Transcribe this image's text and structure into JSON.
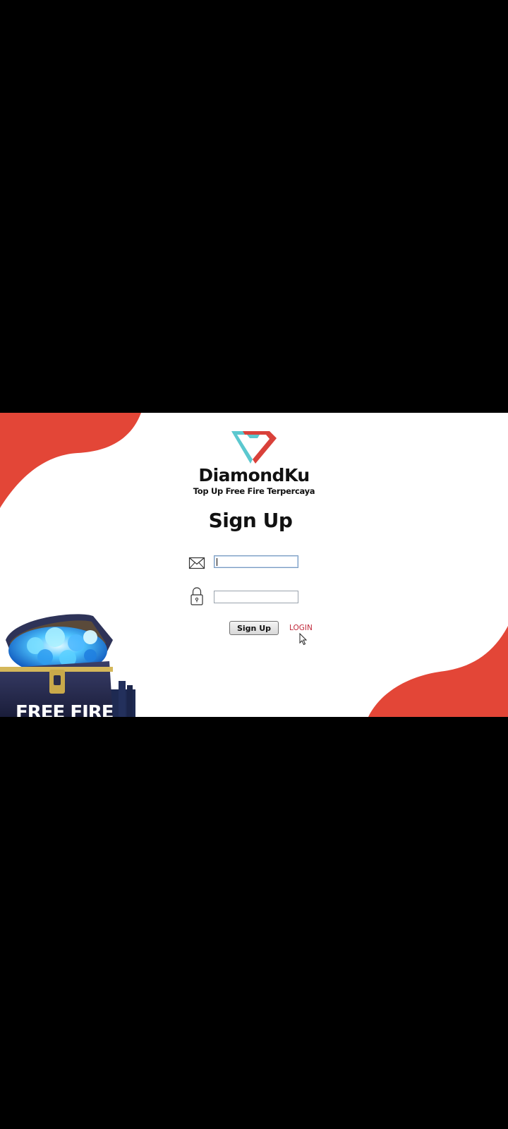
{
  "app": {
    "brand_name": "DiamondKu",
    "tagline": "Top Up Free Fire Terpercaya"
  },
  "form": {
    "title": "Sign Up",
    "email": {
      "icon": "envelope-icon",
      "value": "",
      "placeholder": ""
    },
    "password": {
      "icon": "lock-icon",
      "value": "",
      "placeholder": ""
    },
    "submit_label": "Sign Up",
    "login_link_label": "LOGIN"
  },
  "artwork": {
    "game_logo_text": "FREE FIRE"
  },
  "colors": {
    "accent_red": "#e34637",
    "logo_teal": "#5bc8cf",
    "logo_red": "#d9413a",
    "link_red": "#c0283a",
    "background": "#ffffff",
    "letterbox": "#000000"
  }
}
